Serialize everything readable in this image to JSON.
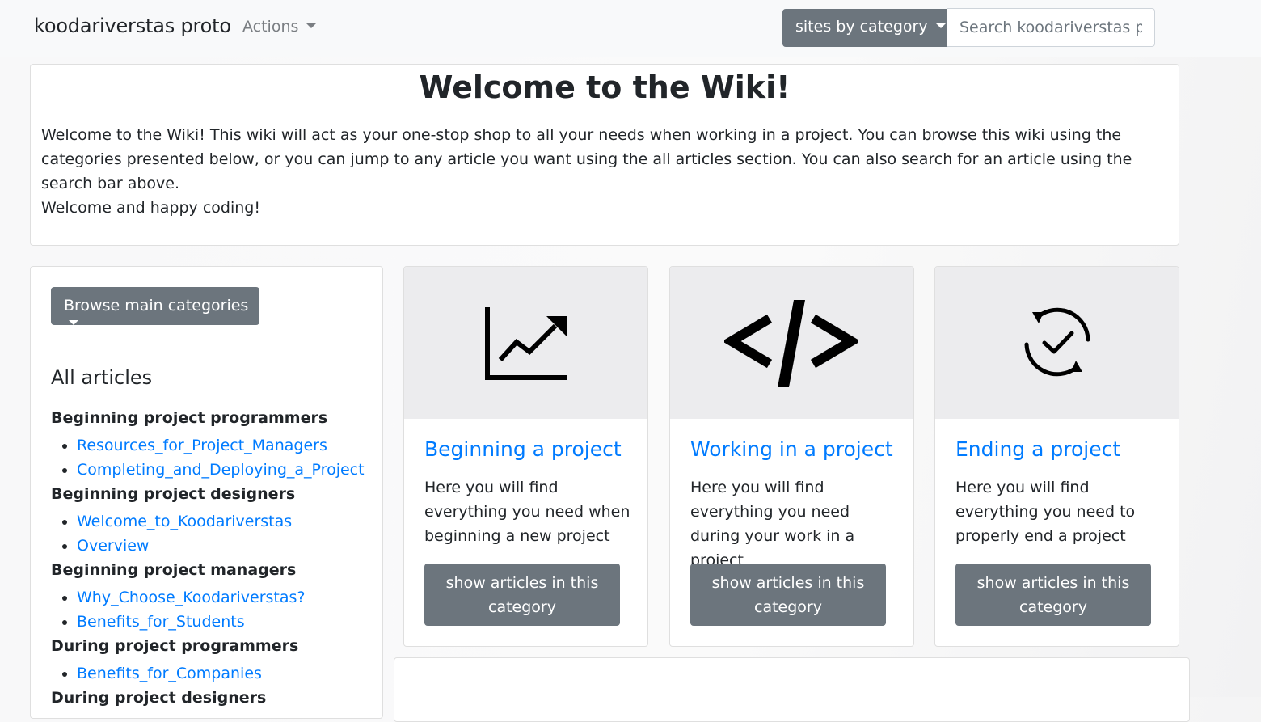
{
  "navbar": {
    "brand": "koodariverstas proto",
    "actions_label": "Actions",
    "sites_label": "sites by category",
    "search_placeholder": "Search koodariverstas p"
  },
  "welcome": {
    "title": "Welcome to the Wiki!",
    "intro": "Welcome to the Wiki! This wiki will act as your one-stop shop to all your needs when working in a project. You can browse this wiki using the categories presented below, or you can jump to any article you want using the all articles section. You can also search for an article using the search bar above.",
    "greeting": "Welcome and happy coding!"
  },
  "sidebar": {
    "browse_label": "Browse main categories",
    "all_articles_title": "All articles",
    "groups": [
      {
        "title": "Beginning project programmers",
        "links": [
          "Resources_for_Project_Managers",
          "Completing_and_Deploying_a_Project"
        ]
      },
      {
        "title": "Beginning project designers",
        "links": [
          "Welcome_to_Koodariverstas",
          "Overview"
        ]
      },
      {
        "title": "Beginning project managers",
        "links": [
          "Why_Choose_Koodariverstas?",
          "Benefits_for_Students"
        ]
      },
      {
        "title": "During project programmers",
        "links": [
          "Benefits_for_Companies"
        ]
      },
      {
        "title": "During project designers",
        "links": []
      }
    ]
  },
  "cards": [
    {
      "icon": "chart-trend-icon",
      "title": "Beginning a project",
      "text": "Here you will find everything you need when beginning a new project",
      "button": "show articles in this category"
    },
    {
      "icon": "code-icon",
      "title": "Working in a project",
      "text": "Here you will find everything you need during your work in a project",
      "button": "show articles in this category"
    },
    {
      "icon": "sync-check-icon",
      "title": "Ending a project",
      "text": "Here you will find everything you need to properly end a project",
      "button": "show articles in this category"
    }
  ],
  "colors": {
    "primary": "#007bff",
    "secondary": "#6c757d",
    "navbar_bg": "#f8f9fa"
  }
}
